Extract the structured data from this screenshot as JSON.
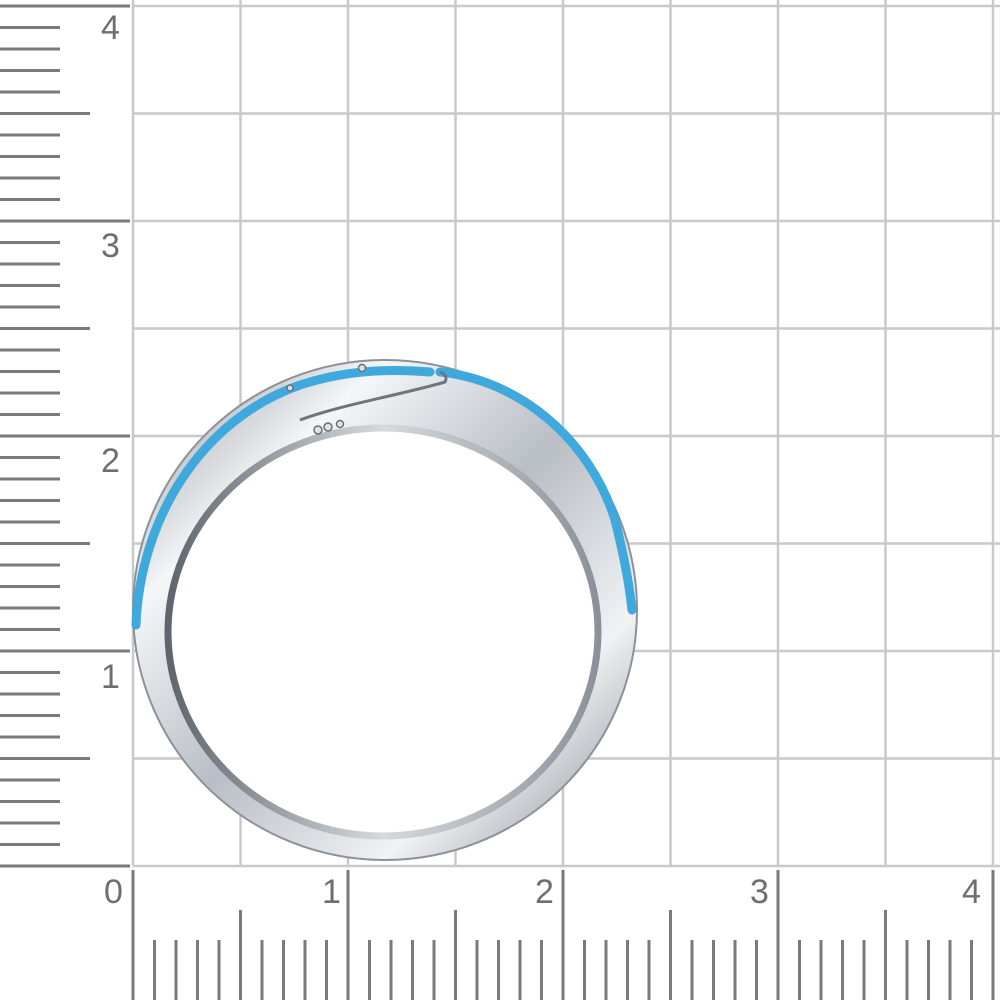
{
  "photo": {
    "subject": "ring-photo",
    "colors": {
      "background": "#ffffff",
      "grid_line": "#c9c9c9",
      "ruler_tick": "#7a7a7a",
      "ruler_label": "#6e6e6e",
      "metal_light": "#f2f4f6",
      "metal_mid": "#c9ced4",
      "metal_dark": "#6f757d",
      "enamel": "#3fa9de"
    }
  },
  "bottom_ruler": {
    "labels": [
      "0",
      "1",
      "2",
      "3",
      "4"
    ]
  },
  "left_ruler": {
    "labels": [
      "1",
      "2",
      "3",
      "4"
    ]
  }
}
